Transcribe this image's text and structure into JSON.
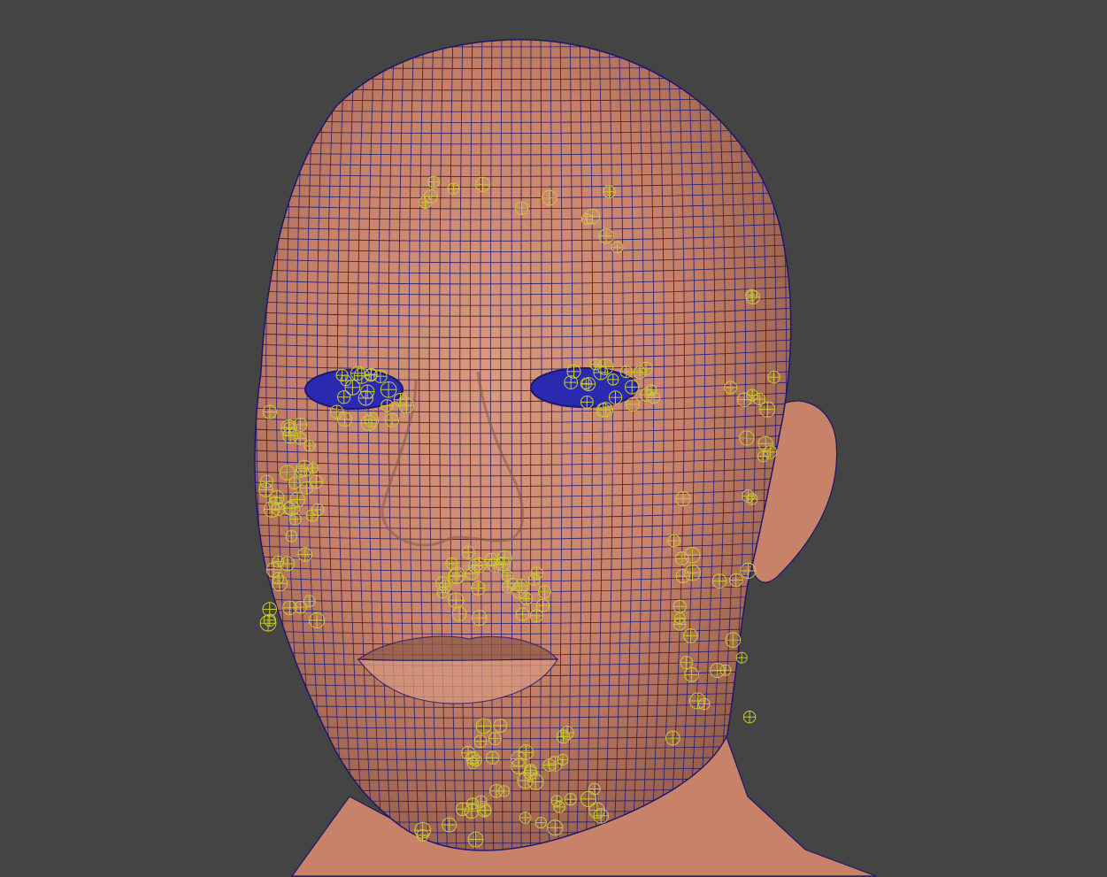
{
  "viewport": {
    "background_color": "#444444",
    "panel": "3d-viewport",
    "display_mode": "smooth-shaded-with-wireframe"
  },
  "model": {
    "subject": "male-head",
    "skin_color": "#c8826a",
    "skin_highlight": "#d89a80",
    "skin_shadow": "#8f5a48",
    "wireframe_color": "#1f1670",
    "eye_color": "#2a2ab0"
  },
  "rig": {
    "control_type": "joint-locator",
    "control_color": "#c8c832",
    "visible": true
  }
}
